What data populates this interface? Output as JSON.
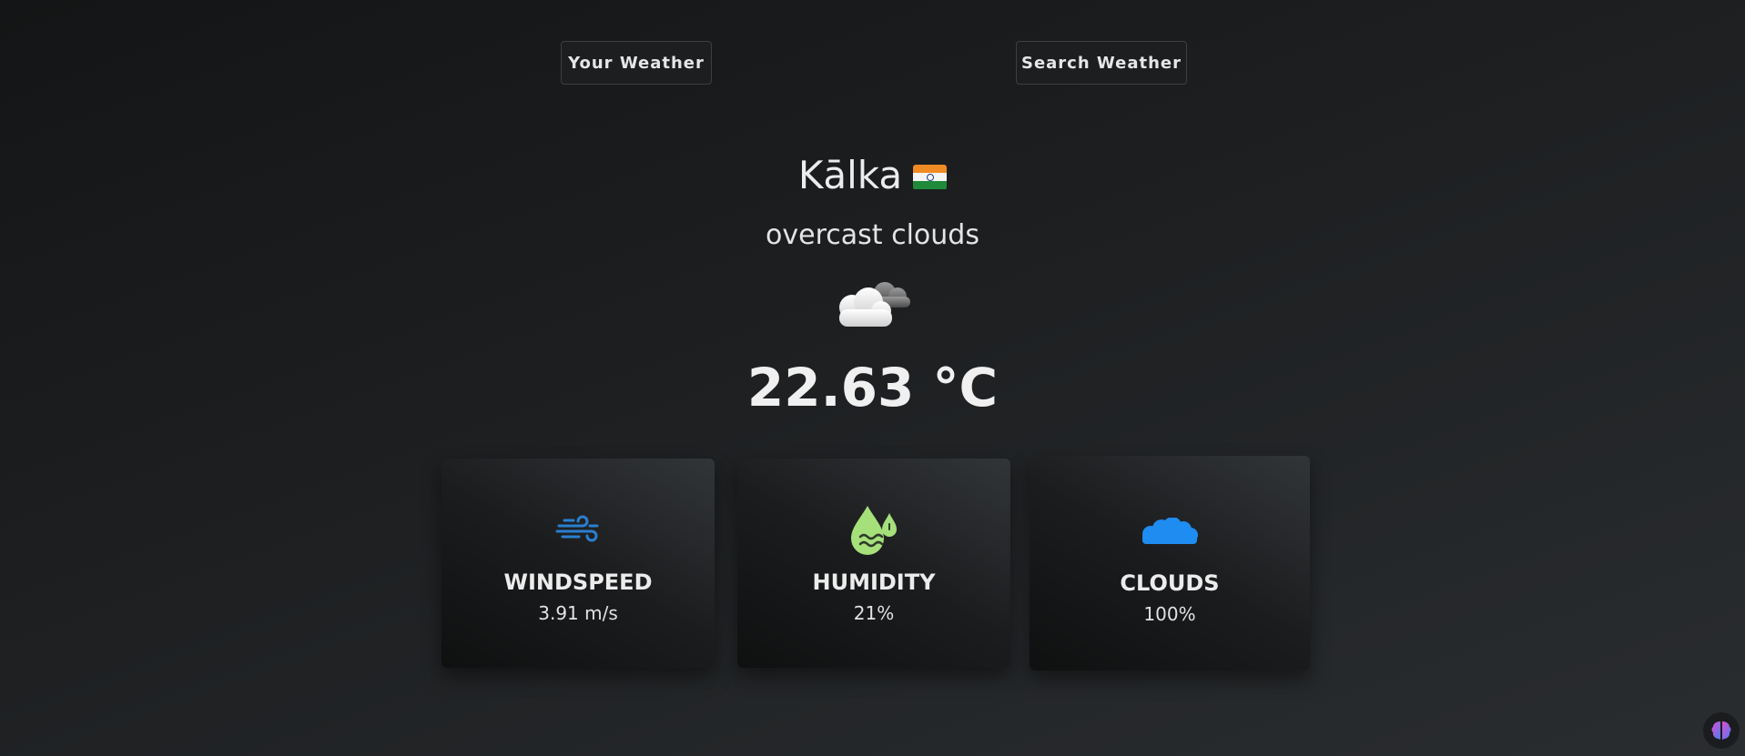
{
  "tabs": {
    "your_weather": "Your Weather",
    "search_weather": "Search Weather"
  },
  "location": {
    "city": "Kālka",
    "country_flag_icon": "india-flag-icon"
  },
  "weather": {
    "description": "overcast clouds",
    "icon": "overcast-clouds-icon",
    "temperature": "22.63 °C"
  },
  "cards": [
    {
      "icon": "wind-icon",
      "label": "WINDSPEED",
      "value": "3.91 m/s"
    },
    {
      "icon": "humidity-icon",
      "label": "HUMIDITY",
      "value": "21%"
    },
    {
      "icon": "clouds-icon",
      "label": "CLOUDS",
      "value": "100%"
    }
  ],
  "colors": {
    "wind_icon": "#2a7fd0",
    "humidity_icon": "#a5e07a",
    "clouds_icon": "#1e8cf0"
  }
}
